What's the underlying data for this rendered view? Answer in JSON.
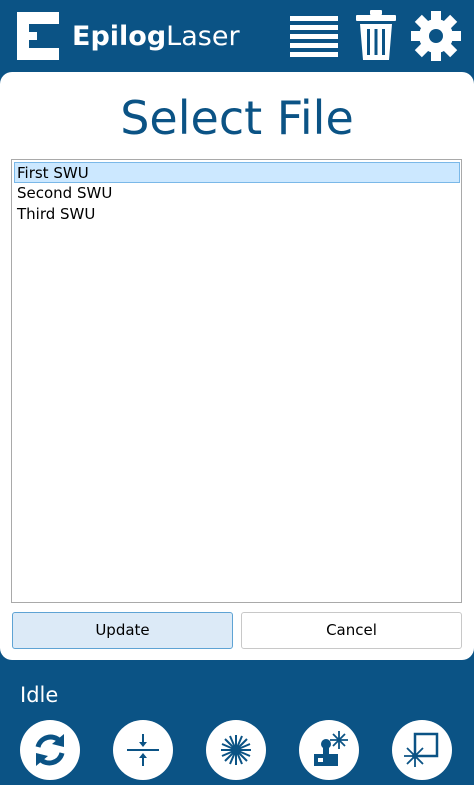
{
  "header": {
    "brand_bold": "Epilog",
    "brand_light": "Laser",
    "icons": [
      "logo-mark-icon",
      "list-icon",
      "trash-icon",
      "gear-icon"
    ]
  },
  "main": {
    "title": "Select File",
    "files": [
      "First SWU",
      "Second SWU",
      "Third SWU"
    ],
    "selected_index": 0,
    "update_label": "Update",
    "cancel_label": "Cancel"
  },
  "footer": {
    "status": "Idle",
    "icons": [
      "refresh-icon",
      "focus-icon",
      "laser-icon",
      "jog-laser-icon",
      "frame-laser-icon"
    ]
  },
  "colors": {
    "brand_blue": "#0b5385",
    "selection": "#cce8ff",
    "update_bg": "#dceaf7"
  }
}
